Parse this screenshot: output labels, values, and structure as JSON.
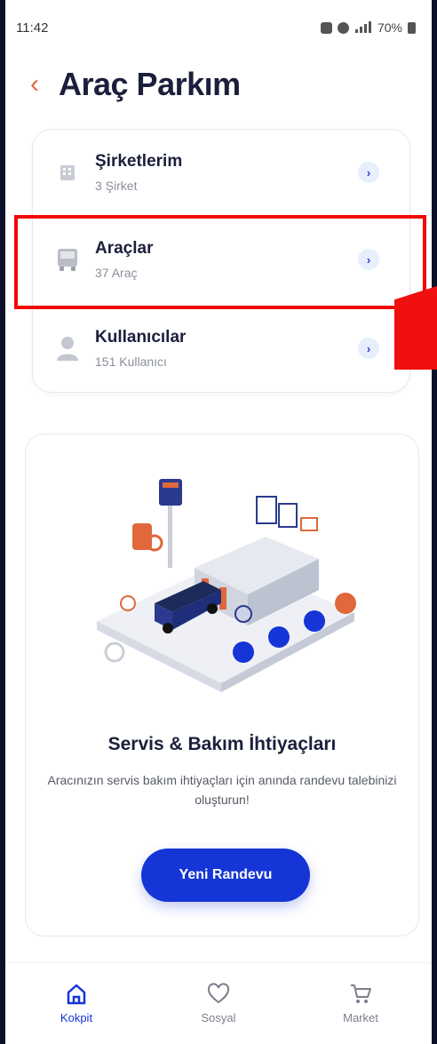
{
  "status_bar": {
    "time": "11:42",
    "battery": "70%"
  },
  "header": {
    "title": "Araç Parkım"
  },
  "menu": [
    {
      "label": "Şirketlerim",
      "sub": "3 Şirket"
    },
    {
      "label": "Araçlar",
      "sub": "37 Araç"
    },
    {
      "label": "Kullanıcılar",
      "sub": "151 Kullanıcı"
    }
  ],
  "promo": {
    "title": "Servis & Bakım İhtiyaçları",
    "description": "Aracınızın servis bakım ihtiyaçları için anında randevu talebinizi oluşturun!",
    "button": "Yeni Randevu"
  },
  "bottom_nav": [
    {
      "label": "Kokpit",
      "icon": "home-icon",
      "active": true
    },
    {
      "label": "Sosyal",
      "icon": "heart-icon",
      "active": false
    },
    {
      "label": "Market",
      "icon": "cart-icon",
      "active": false
    }
  ],
  "colors": {
    "accent": "#1535d6",
    "back": "#e0683b",
    "highlight": "#f20808"
  }
}
